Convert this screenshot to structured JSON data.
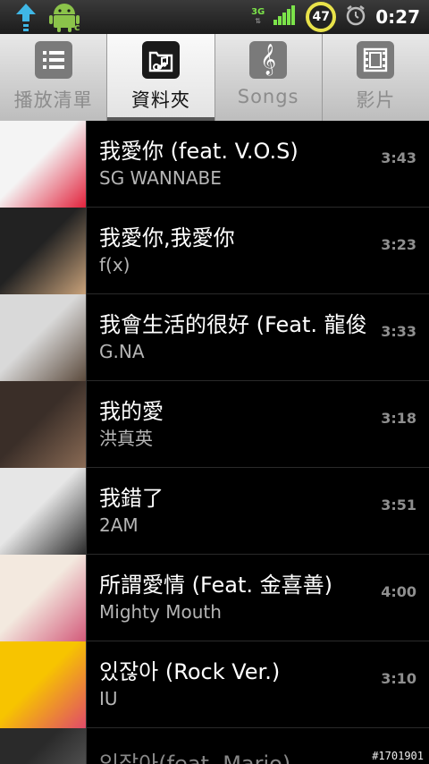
{
  "statusbar": {
    "network": "3G",
    "battery_percent": "47",
    "time": "0:27",
    "signal_bars": 4
  },
  "tabs": [
    {
      "label": "播放清單",
      "icon": "playlist-icon",
      "active": false
    },
    {
      "label": "資料夾",
      "icon": "folder-music-icon",
      "active": true
    },
    {
      "label": "Songs",
      "icon": "treble-clef-icon",
      "active": false
    },
    {
      "label": "影片",
      "icon": "film-icon",
      "active": false
    }
  ],
  "songs": [
    {
      "title": "我愛你 (feat. V.O.S)",
      "artist": "SG WANNABE",
      "duration": "3:43",
      "art_colors": [
        "#f4f4f4",
        "#e2223c"
      ]
    },
    {
      "title": "我愛你,我愛你",
      "artist": "f(x)",
      "duration": "3:23",
      "art_colors": [
        "#222222",
        "#c9a27a"
      ]
    },
    {
      "title": "我會生活的很好 (Feat. 龍俊",
      "artist": "G.NA",
      "duration": "3:33",
      "art_colors": [
        "#d9d9d9",
        "#5b4a3c"
      ]
    },
    {
      "title": "我的愛",
      "artist": "洪真英",
      "duration": "3:18",
      "art_colors": [
        "#3a2e28",
        "#8a6b55"
      ]
    },
    {
      "title": "我錯了",
      "artist": "2AM",
      "duration": "3:51",
      "art_colors": [
        "#e6e6e6",
        "#2a2a2a"
      ]
    },
    {
      "title": "所謂愛情 (Feat. 金喜善)",
      "artist": "Mighty Mouth",
      "duration": "4:00",
      "art_colors": [
        "#f3e9df",
        "#d35a7a"
      ]
    },
    {
      "title": "있잖아 (Rock Ver.)",
      "artist": "IU",
      "duration": "3:10",
      "art_colors": [
        "#f7c400",
        "#e04a6a"
      ]
    },
    {
      "title": "있잖아(feat. Mario)",
      "artist": "",
      "duration": "",
      "art_colors": [
        "#2a2a2a",
        "#555555"
      ]
    }
  ],
  "watermark": "#1701901"
}
